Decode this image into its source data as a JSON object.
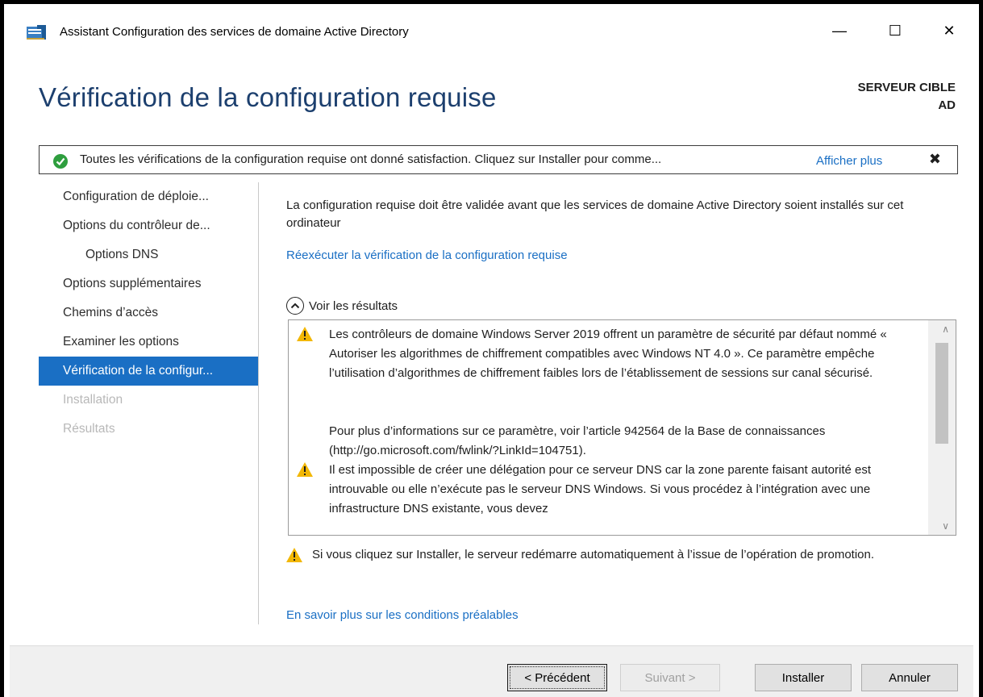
{
  "window": {
    "title": "Assistant Configuration des services de domaine Active Directory",
    "minimize_glyph": "—",
    "maximize_glyph": "☐",
    "close_glyph": "✕"
  },
  "header": {
    "title": "Vérification de la configuration requise",
    "target_line1": "SERVEUR CIBLE",
    "target_line2": "AD"
  },
  "banner": {
    "text": "Toutes les vérifications de la configuration requise ont donné satisfaction. Cliquez sur Installer pour comme...",
    "link": "Afficher plus",
    "close_glyph": "✖",
    "status_color": "#2e9e3e"
  },
  "sidebar": {
    "items": [
      {
        "label": "Configuration de déploie...",
        "state": "normal"
      },
      {
        "label": "Options du contrôleur de...",
        "state": "normal"
      },
      {
        "label": "Options DNS",
        "state": "sub"
      },
      {
        "label": "Options supplémentaires",
        "state": "normal"
      },
      {
        "label": "Chemins d’accès",
        "state": "normal"
      },
      {
        "label": "Examiner les options",
        "state": "normal"
      },
      {
        "label": "Vérification de la configur...",
        "state": "active"
      },
      {
        "label": "Installation",
        "state": "disabled"
      },
      {
        "label": "Résultats",
        "state": "disabled"
      }
    ]
  },
  "main": {
    "intro": "La configuration requise doit être validée avant que les services de domaine Active Directory soient installés sur cet ordinateur",
    "rerun_link": "Réexécuter la vérification de la configuration requise",
    "results_toggle": "Voir les résultats",
    "results": [
      {
        "icon": "warning-icon",
        "para1": "Les contrôleurs de domaine Windows Server 2019 offrent un paramètre de sécurité par défaut nommé « Autoriser les algorithmes de chiffrement compatibles avec Windows NT 4.0 ». Ce paramètre empêche l’utilisation d’algorithmes de chiffrement faibles lors de l’établissement de sessions sur canal sécurisé.",
        "para2": "Pour plus d’informations sur ce paramètre, voir l’article 942564 de la Base de connaissances (http://go.microsoft.com/fwlink/?LinkId=104751)."
      },
      {
        "icon": "warning-icon",
        "para1": "Il est impossible de créer une délégation pour ce serveur DNS car la zone parente faisant autorité est introuvable ou elle n’exécute pas le serveur DNS Windows. Si vous procédez à l’intégration avec une infrastructure DNS existante, vous devez"
      }
    ],
    "restart_warning": "Si vous cliquez sur Installer, le serveur redémarre automatiquement à l’issue de l’opération de promotion.",
    "learn_more_link": "En savoir plus sur les conditions préalables",
    "warning_color": "#f2b705",
    "link_color": "#1a6fc4"
  },
  "footer": {
    "previous": "< Précédent",
    "next": "Suivant >",
    "install": "Installer",
    "cancel": "Annuler"
  }
}
